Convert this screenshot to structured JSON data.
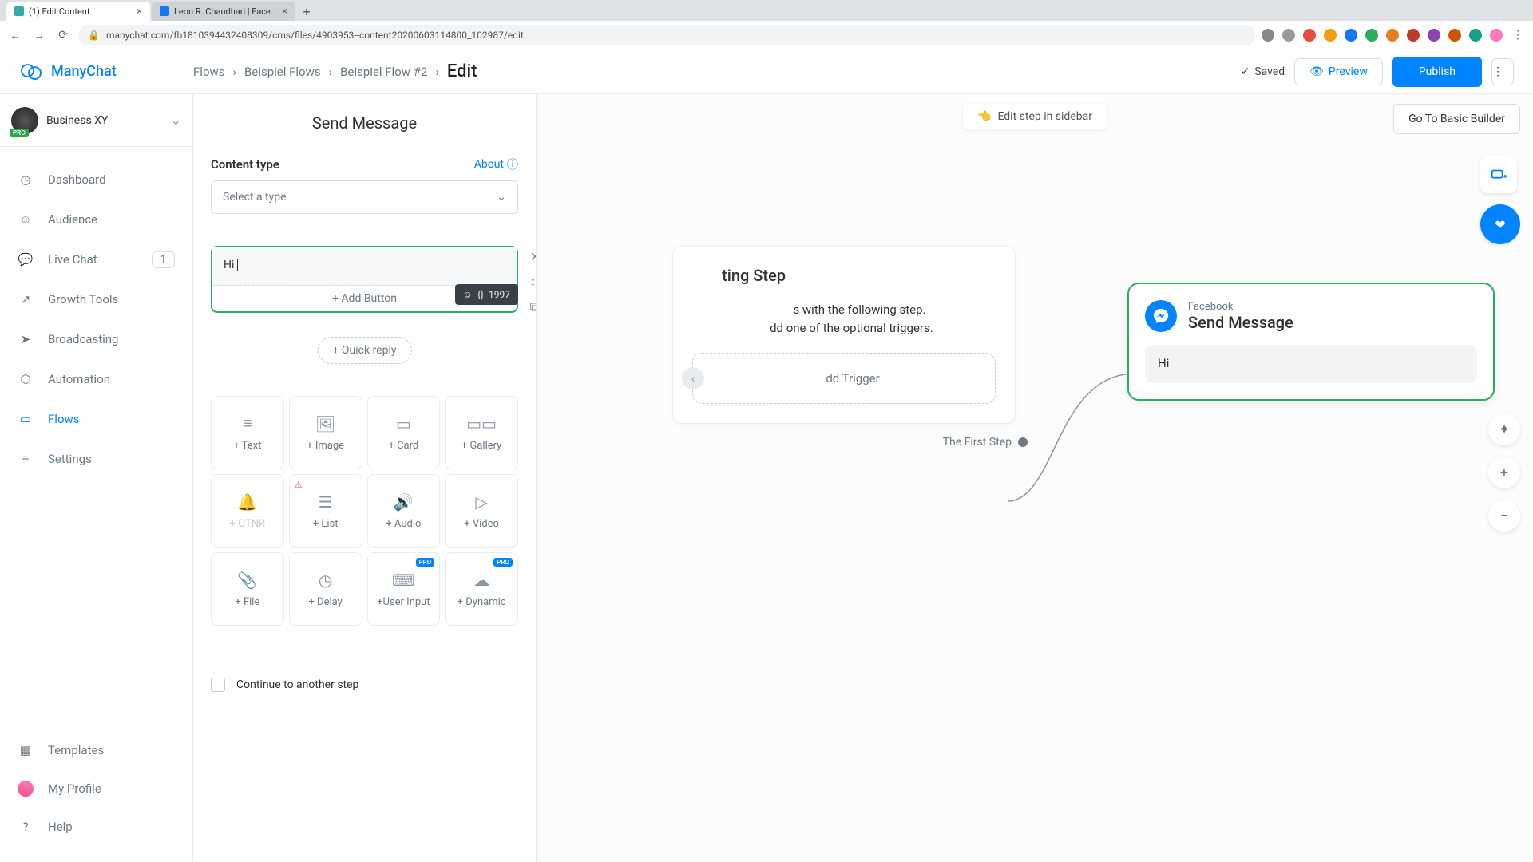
{
  "browser": {
    "tabs": [
      {
        "title": "(1) Edit Content",
        "icon": "#3aa"
      },
      {
        "title": "Leon R. Chaudhari | Facebook",
        "icon": "#1877f2"
      }
    ],
    "url": "manychat.com/fb181039443240​8309/cms/files/4903953--content20200603114800_102987/edit"
  },
  "header": {
    "brand": "ManyChat",
    "breadcrumbs": [
      "Flows",
      "Beispiel Flows",
      "Beispiel Flow #2"
    ],
    "current": "Edit",
    "saved": "Saved",
    "preview": "Preview",
    "publish": "Publish"
  },
  "workspace": {
    "name": "Business XY",
    "badge": "PRO"
  },
  "nav": {
    "items": [
      {
        "label": "Dashboard",
        "icon": "gauge"
      },
      {
        "label": "Audience",
        "icon": "user"
      },
      {
        "label": "Live Chat",
        "icon": "chat",
        "badge": "1"
      },
      {
        "label": "Growth Tools",
        "icon": "growth"
      },
      {
        "label": "Broadcasting",
        "icon": "broadcast"
      },
      {
        "label": "Automation",
        "icon": "automation"
      },
      {
        "label": "Flows",
        "icon": "flows",
        "active": true
      },
      {
        "label": "Settings",
        "icon": "settings"
      }
    ],
    "bottom": [
      {
        "label": "Templates",
        "icon": "templates"
      },
      {
        "label": "My Profile",
        "icon": "avatar"
      },
      {
        "label": "Help",
        "icon": "help"
      }
    ]
  },
  "panel": {
    "title": "Send Message",
    "content_type_label": "Content type",
    "about": "About",
    "select_placeholder": "Select a type",
    "message_text": "Hi ",
    "add_button": "+ Add Button",
    "char_count": "1997",
    "quick_reply": "+ Quick reply",
    "blocks": [
      {
        "label": "+ Text",
        "icon": "text"
      },
      {
        "label": "+ Image",
        "icon": "image"
      },
      {
        "label": "+ Card",
        "icon": "card"
      },
      {
        "label": "+ Gallery",
        "icon": "gallery"
      },
      {
        "label": "+ OTNR",
        "icon": "bell",
        "disabled": true
      },
      {
        "label": "+ List",
        "icon": "list",
        "warn": true
      },
      {
        "label": "+ Audio",
        "icon": "audio"
      },
      {
        "label": "+ Video",
        "icon": "video"
      },
      {
        "label": "+ File",
        "icon": "file"
      },
      {
        "label": "+ Delay",
        "icon": "delay"
      },
      {
        "label": "+User Input",
        "icon": "input",
        "pro": true
      },
      {
        "label": "+ Dynamic",
        "icon": "dynamic",
        "pro": true
      }
    ],
    "continue": "Continue to another step"
  },
  "canvas": {
    "edit_sidebar": "Edit step in sidebar",
    "basic_builder": "Go To Basic Builder",
    "start": {
      "title": "Starting Step",
      "desc1": "A flow always starts with the following step.",
      "desc2": "You can also add one of the optional triggers.",
      "trigger": "+ Add Trigger",
      "first_step": "The First Step"
    },
    "message_node": {
      "platform": "Facebook",
      "title": "Send Message",
      "text": "Hi"
    }
  }
}
